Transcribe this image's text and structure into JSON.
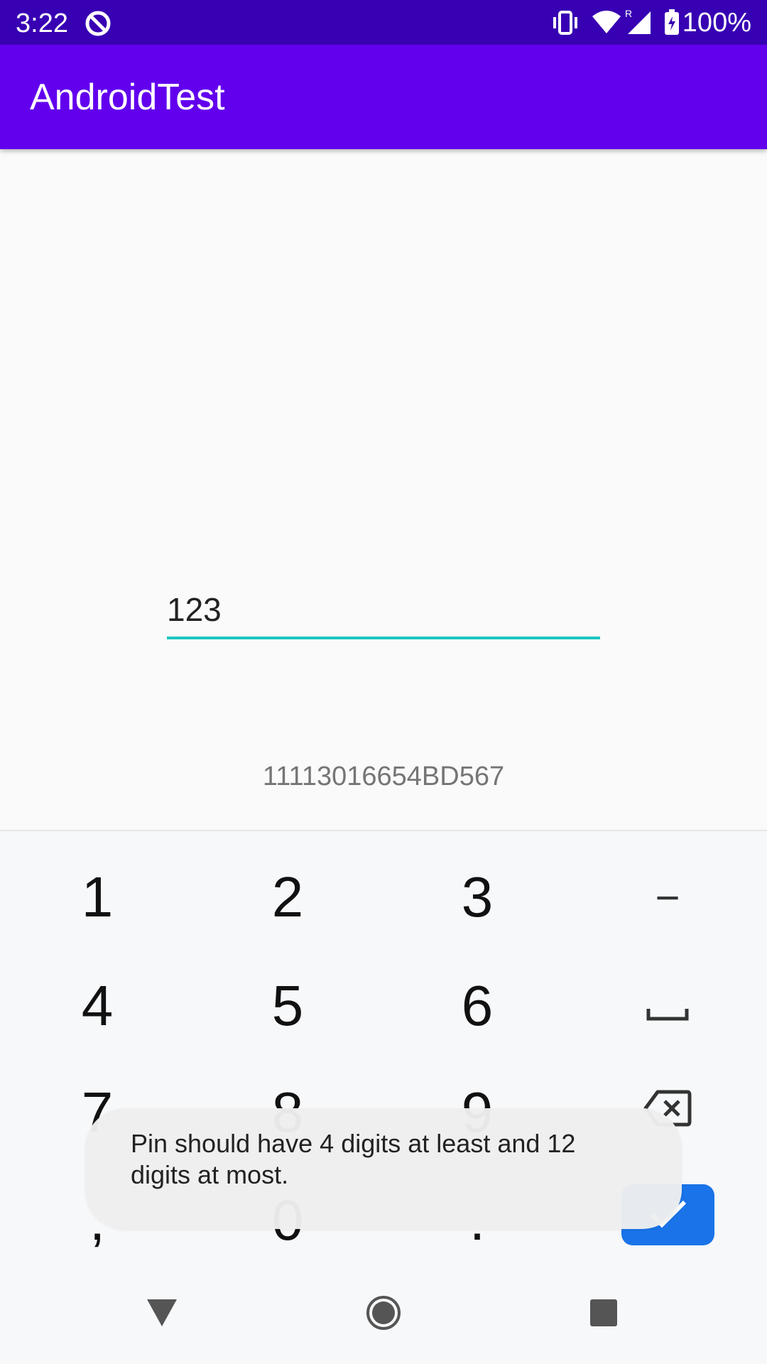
{
  "status_bar": {
    "time": "3:22",
    "battery": "100%",
    "icons": [
      "sync-icon",
      "vibrate-icon",
      "wifi-icon",
      "cell-signal-roaming-icon",
      "battery-charging-icon"
    ]
  },
  "app_bar": {
    "title": "AndroidTest"
  },
  "main": {
    "pin_value": "123",
    "device_id": "11113016654BD567"
  },
  "keyboard": {
    "row1": [
      "1",
      "2",
      "3",
      "−"
    ],
    "row2": [
      "4",
      "5",
      "6"
    ],
    "row3": [
      "7",
      "8",
      "9"
    ],
    "row4": [
      ",",
      "0",
      "."
    ],
    "accent_color": "#1a73e8"
  },
  "toast": {
    "message": "Pin should have 4 digits at least and 12 digits at most."
  },
  "colors": {
    "status_bar": "#3700b3",
    "app_bar": "#6200ee",
    "input_underline": "#1cc7c0"
  }
}
